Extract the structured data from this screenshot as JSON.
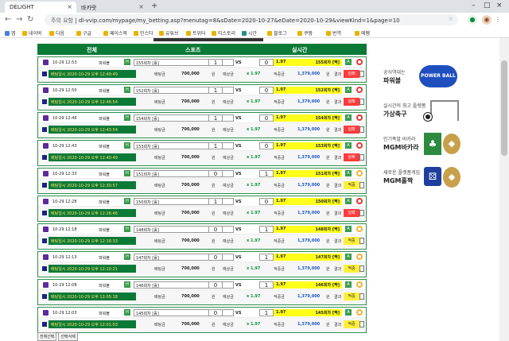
{
  "browser": {
    "tabs": [
      {
        "label": "DELIGHT"
      },
      {
        "label": "바카랏"
      }
    ],
    "address": {
      "security": "주의 요함",
      "url": "dl-vvip.com/mypage/my_betting.asp?menutag=8&sDate=2020-10-27&eDate=2020-10-29&viewKind=1&page=10"
    },
    "bookmarks": [
      "앱",
      "네이버",
      "다음",
      "구글",
      "페이스북",
      "인스타",
      "유튜브",
      "트위터",
      "티스토리",
      "시간",
      "블로그",
      "쿠팡",
      "번역",
      "에펨"
    ]
  },
  "header": {
    "col1": "전체",
    "col2": "스포츠",
    "col3": "실시간"
  },
  "labels": {
    "bet_amount": "배팅금",
    "win_amount": "예상금",
    "odds_label": "적중금",
    "result": "결과",
    "unit": "원"
  },
  "rows": [
    {
      "time": "10-29 12:53",
      "game": "파워볼",
      "pick": "155회차 [홀]",
      "odds": "1.97",
      "score": "1",
      "h": "0",
      "bar": "155회차 [짝]",
      "date": "배팅일시 2020-10-29 오후 12:49:49",
      "bet": "700,000",
      "mult": "x 1.97",
      "payout": "1,379,000",
      "result": "실패",
      "win": false
    },
    {
      "time": "10-29 12:50",
      "game": "파워볼",
      "pick": "152회차 [홀]",
      "odds": "1.97",
      "score": "1",
      "h": "0",
      "bar": "152회차 [짝]",
      "date": "배팅일시 2020-10-29 오후 12:46:54",
      "bet": "700,000",
      "mult": "x 1.97",
      "payout": "1,379,000",
      "result": "실패",
      "win": false
    },
    {
      "time": "10-29 12:46",
      "game": "파워볼",
      "pick": "154회차 [홀]",
      "odds": "1.97",
      "score": "1",
      "h": "0",
      "bar": "154회차 [짝]",
      "date": "배팅일시 2020-10-29 오후 12:43:54",
      "bet": "700,000",
      "mult": "x 1.97",
      "payout": "1,379,000",
      "result": "실패",
      "win": false
    },
    {
      "time": "10-29 12:43",
      "game": "파워볼",
      "pick": "153회차 [홀]",
      "odds": "1.97",
      "score": "1",
      "h": "0",
      "bar": "153회차 [짝]",
      "date": "배팅일시 2020-10-29 오후 12:40:49",
      "bet": "700,000",
      "mult": "x 1.97",
      "payout": "1,379,000",
      "result": "실패",
      "win": false
    },
    {
      "time": "10-29 12:33",
      "game": "파워볼",
      "pick": "151회차 [홀]",
      "odds": "1.97",
      "score": "0",
      "h": "1",
      "bar": "151회차 [짝]",
      "date": "배팅일시 2020-10-29 오후 12:30:57",
      "bet": "700,000",
      "mult": "x 1.97",
      "payout": "1,379,000",
      "result": "적중",
      "win": true
    },
    {
      "time": "10-29 12:28",
      "game": "파워볼",
      "pick": "150회차 [홀]",
      "odds": "1.97",
      "score": "1",
      "h": "0",
      "bar": "150회차 [짝]",
      "date": "배팅일시 2020-10-29 오후 12:26:46",
      "bet": "700,000",
      "mult": "x 1.97",
      "payout": "1,379,000",
      "result": "실패",
      "win": false
    },
    {
      "time": "10-29 12:18",
      "game": "파워볼",
      "pick": "148회차 [홀]",
      "odds": "1.97",
      "score": "0",
      "h": "1",
      "bar": "148회차 [짝]",
      "date": "배팅일시 2020-10-29 오후 12:16:33",
      "bet": "700,000",
      "mult": "x 1.97",
      "payout": "1,379,000",
      "result": "적중",
      "win": true
    },
    {
      "time": "10-29 12:13",
      "game": "파워볼",
      "pick": "147회차 [홀]",
      "odds": "1.97",
      "score": "0",
      "h": "1",
      "bar": "147회차 [짝]",
      "date": "배팅일시 2020-10-29 오후 12:10:21",
      "bet": "700,000",
      "mult": "x 1.97",
      "payout": "1,379,000",
      "result": "적중",
      "win": true
    },
    {
      "time": "10-29 12:08",
      "game": "파워볼",
      "pick": "146회차 [홀]",
      "odds": "1.97",
      "score": "0",
      "h": "1",
      "bar": "146회차 [짝]",
      "date": "배팅일시 2020-10-29 오후 12:05:18",
      "bet": "700,000",
      "mult": "x 1.97",
      "payout": "1,379,000",
      "result": "적중",
      "win": true
    },
    {
      "time": "10-29 12:03",
      "game": "파워볼",
      "pick": "145회차 [홀]",
      "odds": "1.97",
      "score": "0",
      "h": "1",
      "bar": "145회차 [짝]",
      "date": "배팅일시 2020-10-29 오후 12:01:03",
      "bet": "700,000",
      "mult": "x 1.97",
      "payout": "1,379,000",
      "result": "적중",
      "win": true
    }
  ],
  "sidebar": [
    {
      "line1": "공식역대는",
      "line2": "파워볼"
    },
    {
      "line1": "실시간의 최고 플렛폼",
      "line2": "가상축구"
    },
    {
      "line1": "인기폭발 바카라",
      "line2": "MGM바카라"
    },
    {
      "line1": "새로운 플랫폼게임",
      "line2": "MGM홀짝"
    }
  ],
  "bottom_buttons": [
    "전체선택",
    "선택삭제"
  ]
}
